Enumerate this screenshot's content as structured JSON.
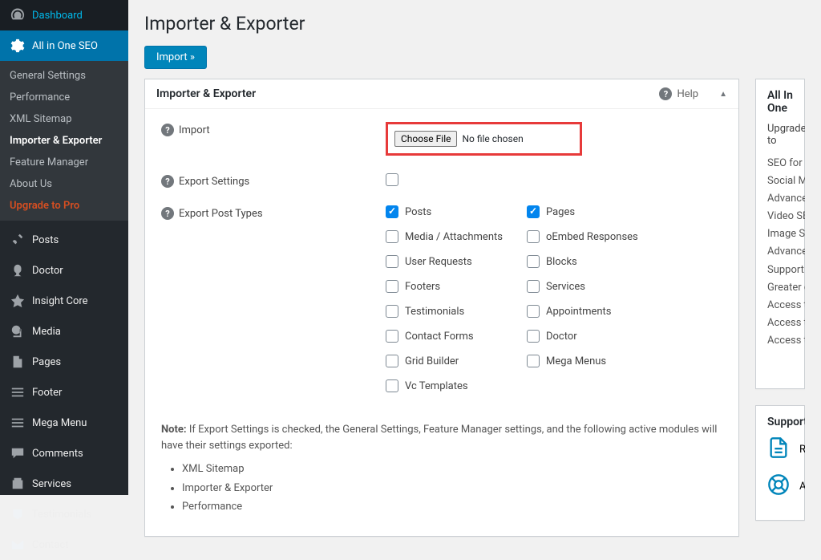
{
  "sidebar": {
    "main": [
      {
        "label": "Dashboard",
        "icon": "dashboard"
      },
      {
        "label": "All in One SEO",
        "icon": "gear",
        "active": true
      }
    ],
    "submenu": [
      {
        "label": "General Settings"
      },
      {
        "label": "Performance"
      },
      {
        "label": "XML Sitemap"
      },
      {
        "label": "Importer & Exporter",
        "active": true
      },
      {
        "label": "Feature Manager"
      },
      {
        "label": "About Us"
      },
      {
        "label": "Upgrade to Pro",
        "upgrade": true
      }
    ],
    "main2": [
      {
        "label": "Posts",
        "icon": "pin"
      },
      {
        "label": "Doctor",
        "icon": "doctor"
      },
      {
        "label": "Insight Core",
        "icon": "insight"
      },
      {
        "label": "Media",
        "icon": "media"
      },
      {
        "label": "Pages",
        "icon": "pages"
      },
      {
        "label": "Footer",
        "icon": "list"
      },
      {
        "label": "Mega Menu",
        "icon": "list"
      },
      {
        "label": "Comments",
        "icon": "comment"
      },
      {
        "label": "Services",
        "icon": "services"
      },
      {
        "label": "Testimonials",
        "icon": "testimonials"
      },
      {
        "label": "Contact",
        "icon": "contact"
      }
    ]
  },
  "page": {
    "title": "Importer & Exporter",
    "import_button": "Import »",
    "panel_title": "Importer & Exporter",
    "help_label": "Help",
    "labels": {
      "import": "Import",
      "export_settings": "Export Settings",
      "export_post_types": "Export Post Types"
    },
    "file": {
      "button": "Choose File",
      "status": "No file chosen"
    },
    "post_types_col1": [
      {
        "label": "Posts",
        "checked": true
      },
      {
        "label": "Media / Attachments",
        "checked": false
      },
      {
        "label": "User Requests",
        "checked": false
      },
      {
        "label": "Footers",
        "checked": false
      },
      {
        "label": "Testimonials",
        "checked": false
      },
      {
        "label": "Contact Forms",
        "checked": false
      },
      {
        "label": "Grid Builder",
        "checked": false
      },
      {
        "label": "Vc Templates",
        "checked": false
      }
    ],
    "post_types_col2": [
      {
        "label": "Pages",
        "checked": true
      },
      {
        "label": "oEmbed Responses",
        "checked": false
      },
      {
        "label": "Blocks",
        "checked": false
      },
      {
        "label": "Services",
        "checked": false
      },
      {
        "label": "Appointments",
        "checked": false
      },
      {
        "label": "Doctor",
        "checked": false
      },
      {
        "label": "Mega Menus",
        "checked": false
      }
    ],
    "note_prefix": "Note:",
    "note": " If Export Settings is checked, the General Settings, Feature Manager settings, and the following active modules will have their settings exported:",
    "note_items": [
      "XML Sitemap",
      "Importer & Exporter",
      "Performance"
    ]
  },
  "side": {
    "box1_title": "All In One",
    "box1_sub": "Upgrade to",
    "box1_items": [
      "SEO for Cate",
      "Social Meta",
      "Advanced su",
      "Video SEO M",
      "Image SEO",
      "Advanced G",
      "Support for",
      "Greater cont",
      "Access to Vi",
      "Access to Pr",
      "Access to Kn"
    ],
    "box2_title": "Support",
    "box2_items": [
      "Rea",
      "Acc"
    ]
  }
}
